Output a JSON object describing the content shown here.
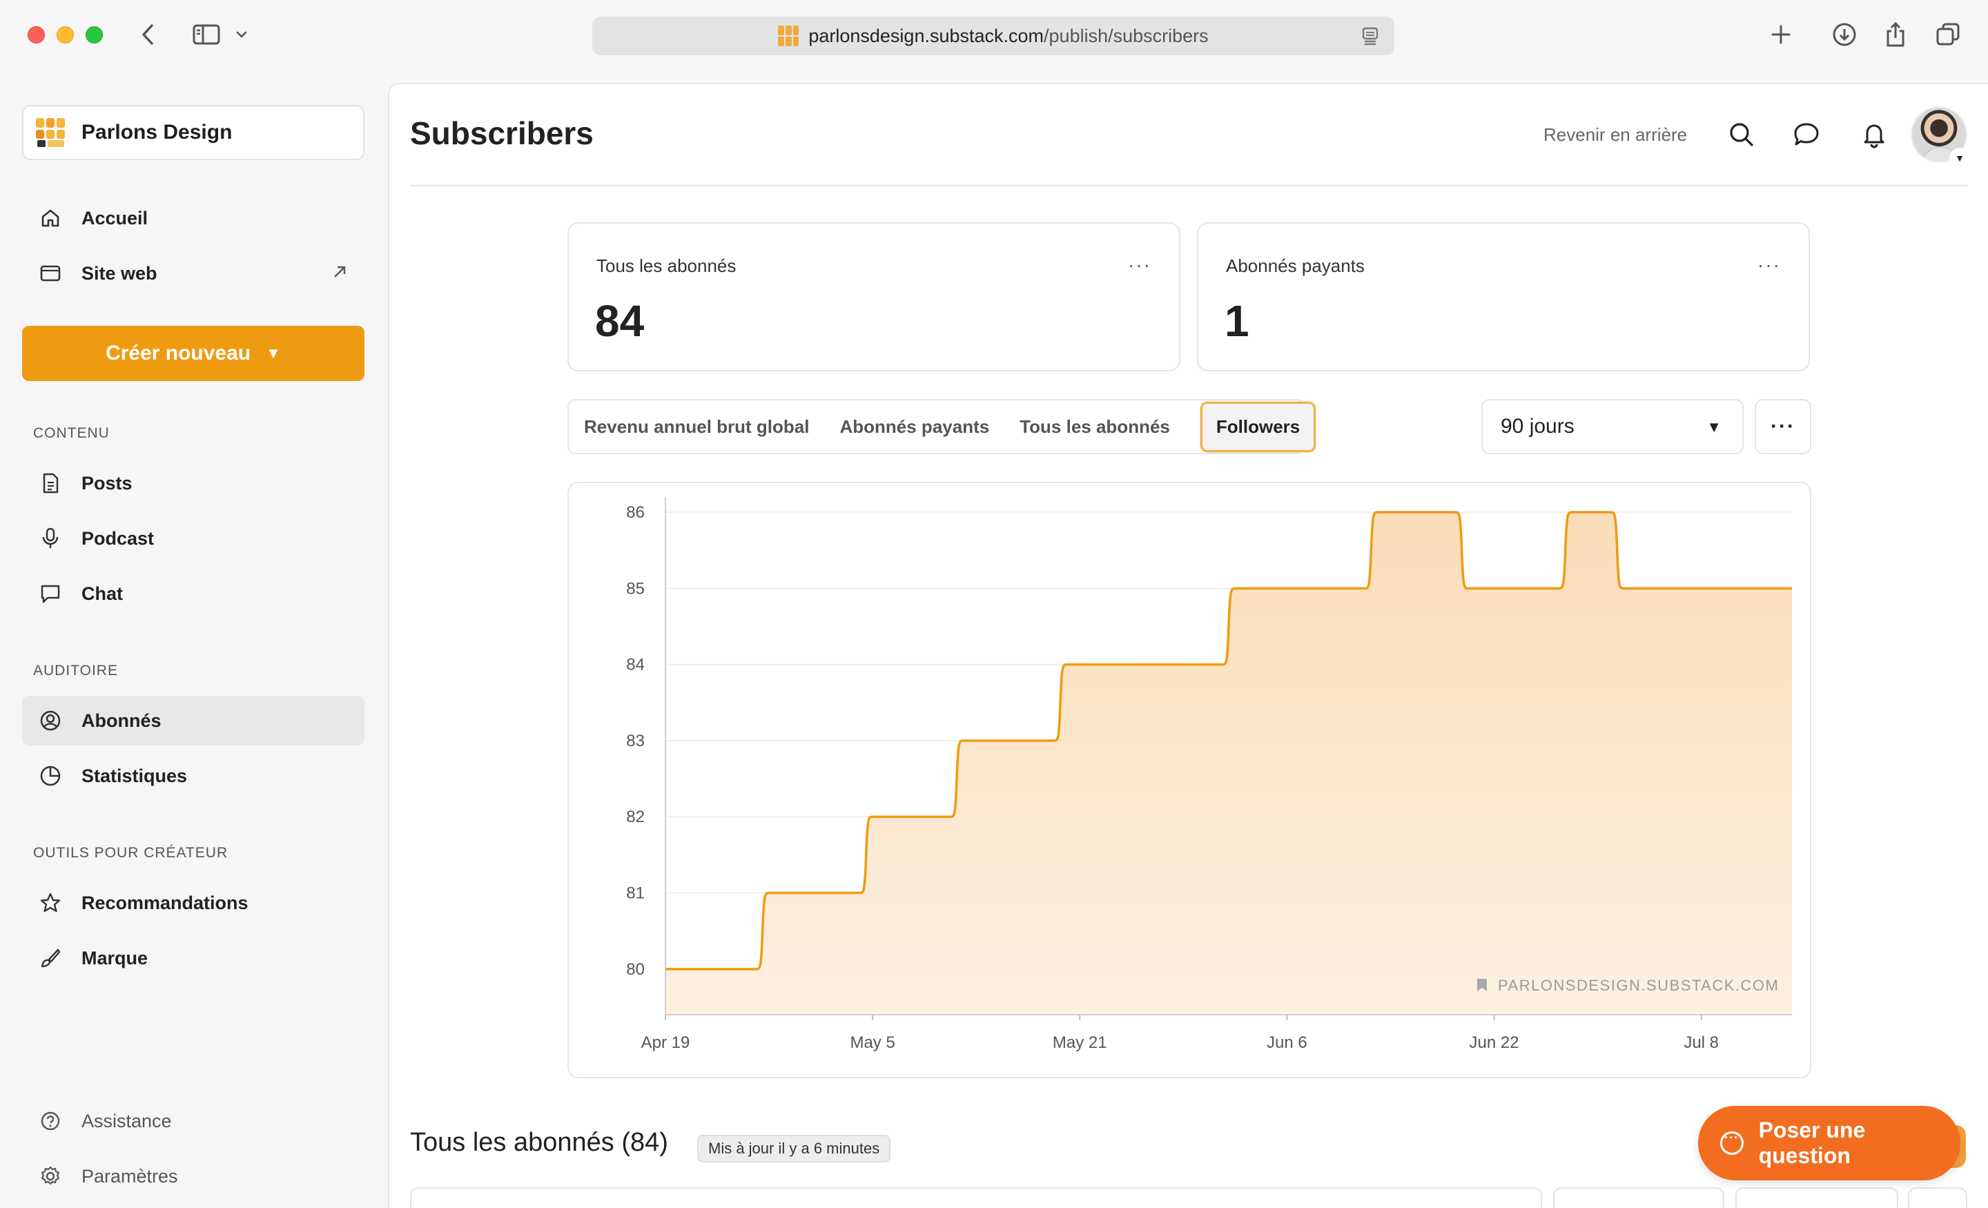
{
  "browser": {
    "url_host": "parlonsdesign.substack.com",
    "url_path": "/publish/subscribers"
  },
  "sidebar": {
    "publication": "Parlons Design",
    "home": "Accueil",
    "website": "Site web",
    "create_button": "Créer nouveau",
    "sections": {
      "content": "CONTENU",
      "audience": "AUDITOIRE",
      "creator_tools": "OUTILS POUR CRÉATEUR"
    },
    "content_items": [
      "Posts",
      "Podcast",
      "Chat"
    ],
    "audience_items": [
      "Abonnés",
      "Statistiques"
    ],
    "tools_items": [
      "Recommandations",
      "Marque"
    ],
    "footer_items": [
      "Assistance",
      "Paramètres"
    ]
  },
  "header": {
    "title": "Subscribers",
    "back_link": "Revenir en arrière"
  },
  "stats": {
    "all": {
      "label": "Tous les abonnés",
      "value": "84",
      "more": "···"
    },
    "paid": {
      "label": "Abonnés payants",
      "value": "1",
      "more": "···"
    }
  },
  "tabs": [
    "Revenu annuel brut global",
    "Abonnés payants",
    "Tous les abonnés",
    "Followers"
  ],
  "selected_tab": "Followers",
  "period_select": {
    "value": "90 jours"
  },
  "more_menu": "···",
  "chart_data": {
    "type": "area",
    "series": [
      {
        "values_x": [
          "Apr 19",
          "Apr 26",
          "Apr 27",
          "May 4",
          "May 5",
          "May 11",
          "May 12",
          "May 19",
          "May 20",
          "Jun 1",
          "Jun 2",
          "Jun 12",
          "Jun 13",
          "Jun 19",
          "Jun 20",
          "Jun 27",
          "Jun 28",
          "Jul 1",
          "Jul 2",
          "Jul 6",
          "Jul 7",
          "Jul 15"
        ],
        "values": [
          80,
          80,
          81,
          81,
          82,
          82,
          83,
          83,
          84,
          84,
          85,
          85,
          86,
          86,
          85,
          85,
          86,
          86,
          85,
          85,
          85,
          85
        ]
      }
    ],
    "x_tick_labels": [
      "Apr 19",
      "May 5",
      "May 21",
      "Jun 6",
      "Jun 22",
      "Jul 8"
    ],
    "y_ticks": [
      80,
      81,
      82,
      83,
      84,
      85,
      86
    ],
    "ylim": [
      79.4,
      86.2
    ],
    "watermark": "PARLONSDESIGN.SUBSTACK.COM",
    "colors": {
      "line": "#ef9b11",
      "fill": "#fbe3c2"
    },
    "grid": true
  },
  "list": {
    "title": "Tous les abonnés (84)",
    "updated": "Mis à jour il y a 6 minutes"
  },
  "help_button": "Poser une question",
  "colors": {
    "accent": "#ef9b11",
    "help": "#f26d1f"
  }
}
